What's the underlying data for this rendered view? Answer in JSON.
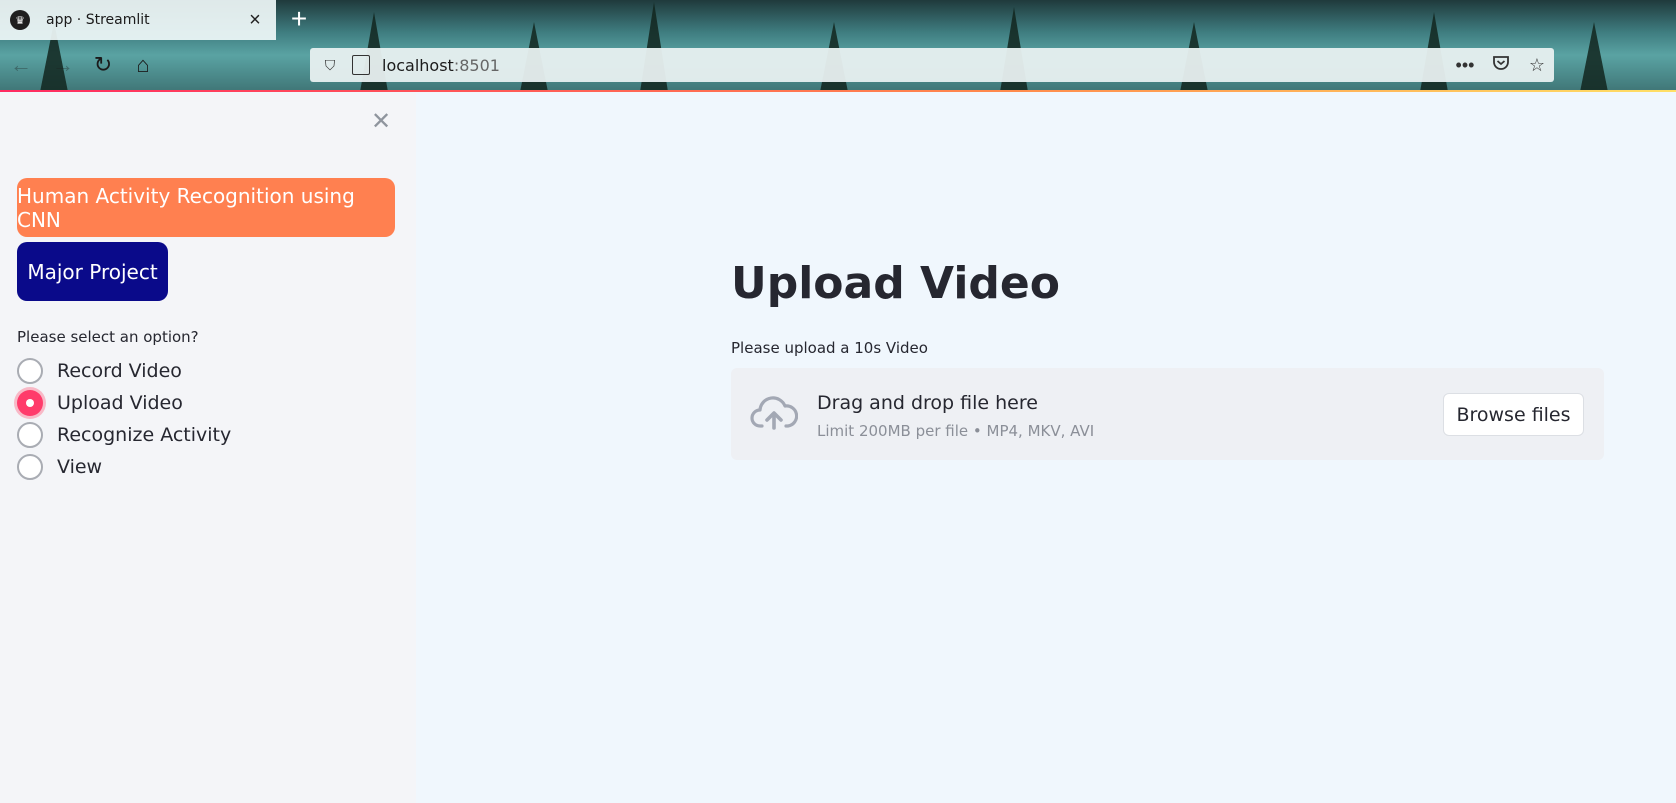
{
  "browser": {
    "tab_title": "app · Streamlit",
    "new_tab_symbol": "+",
    "url_host": "localhost",
    "url_port": ":8501",
    "accent_gradient": [
      "#ff2b61",
      "#ff8a4c",
      "#ffe066"
    ]
  },
  "sidebar": {
    "title_button": "Human Activity Recognition using CNN",
    "project_button": "Major Project",
    "radio_label": "Please select an option?",
    "options": [
      {
        "label": "Record Video",
        "checked": false
      },
      {
        "label": "Upload Video",
        "checked": true
      },
      {
        "label": "Recognize Activity",
        "checked": false
      },
      {
        "label": "View",
        "checked": false
      }
    ],
    "title_button_color": "#ff8050",
    "project_button_color": "#0a0a8a"
  },
  "main": {
    "title": "Upload Video",
    "uploader_label": "Please upload a 10s Video",
    "drop_text": "Drag and drop file here",
    "limit_text": "Limit 200MB per file • MP4, MKV, AVI",
    "browse_label": "Browse files",
    "accent_color": "#ff3b6b"
  }
}
